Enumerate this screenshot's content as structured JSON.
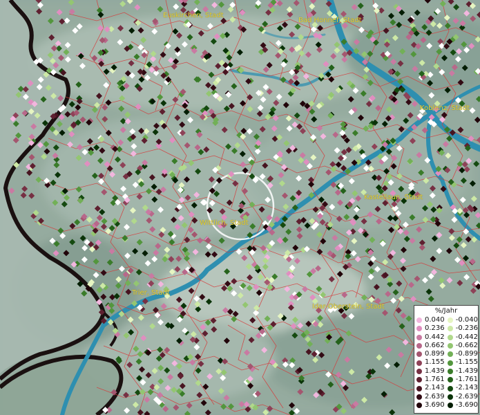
{
  "map": {
    "cities": [
      {
        "id": "euskirchen",
        "label": "Euskirchen, Stadt"
      },
      {
        "id": "bad-honnef",
        "label": "Bad Honnef, Stadt"
      },
      {
        "id": "koblenz",
        "label": "Koblenz, Stadt"
      },
      {
        "id": "wittlich",
        "label": "Wittlich, Stadt"
      },
      {
        "id": "kastellaun",
        "label": "Kastellaun, Stadt"
      },
      {
        "id": "trier",
        "label": "Trier, Stadt"
      },
      {
        "id": "idar-oberstein",
        "label": "Idar-Oberstein, Stadt"
      }
    ],
    "colors": {
      "water": "#2e8fb0",
      "boundary": "#d63a3a",
      "border": "#1a1010",
      "label": "#e8d43a",
      "highlight_ring": "#ffffff"
    }
  },
  "legend": {
    "title": "%/Jahr",
    "positive": [
      {
        "label": "0.040",
        "color": "#f2b6de"
      },
      {
        "label": "0.236",
        "color": "#e08ec0"
      },
      {
        "label": "0.442",
        "color": "#c97aa2"
      },
      {
        "label": "0.662",
        "color": "#b8688a"
      },
      {
        "label": "0.899",
        "color": "#a4566f"
      },
      {
        "label": "1.155",
        "color": "#8e4258"
      },
      {
        "label": "1.439",
        "color": "#763043"
      },
      {
        "label": "1.761",
        "color": "#5e2030"
      },
      {
        "label": "2.143",
        "color": "#471420"
      },
      {
        "label": "2.639",
        "color": "#320b14"
      },
      {
        "label": "3.690",
        "color": "#200409"
      }
    ],
    "negative": [
      {
        "label": "-0.040",
        "color": "#e6f5c2"
      },
      {
        "label": "-0.236",
        "color": "#cde9a6"
      },
      {
        "label": "-0.442",
        "color": "#b1d98c"
      },
      {
        "label": "-0.662",
        "color": "#93c671"
      },
      {
        "label": "-0.899",
        "color": "#72b057"
      },
      {
        "label": "-1.155",
        "color": "#53963d"
      },
      {
        "label": "-1.439",
        "color": "#3a7c2a"
      },
      {
        "label": "-1.761",
        "color": "#25621b"
      },
      {
        "label": "-2.143",
        "color": "#154a10"
      },
      {
        "label": "-2.639",
        "color": "#0a3308"
      },
      {
        "label": "-3.690",
        "color": "#031d03"
      }
    ]
  }
}
